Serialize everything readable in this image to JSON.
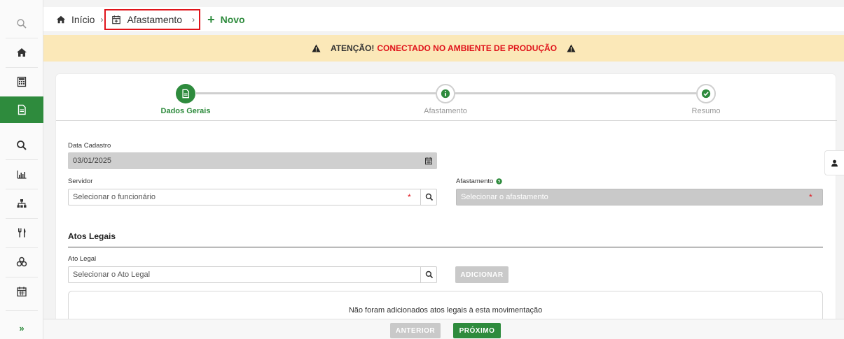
{
  "breadcrumb": {
    "home": "Início",
    "section": "Afastamento",
    "action": "Novo"
  },
  "warning": {
    "prefix": "ATENÇÃO!",
    "message": "CONECTADO NO AMBIENTE DE PRODUÇÃO"
  },
  "steps": [
    {
      "label": "Dados Gerais",
      "state": "active"
    },
    {
      "label": "Afastamento",
      "state": "pending"
    },
    {
      "label": "Resumo",
      "state": "pending"
    }
  ],
  "form": {
    "data_cadastro_label": "Data Cadastro",
    "data_cadastro_value": "03/01/2025",
    "servidor_label": "Servidor",
    "servidor_placeholder": "Selecionar o funcionário",
    "afastamento_label": "Afastamento",
    "afastamento_placeholder": "Selecionar o afastamento"
  },
  "atos": {
    "title": "Atos Legais",
    "field_label": "Ato Legal",
    "placeholder": "Selecionar o Ato Legal",
    "add_button": "ADICIONAR",
    "empty_message": "Não foram adicionados atos legais à esta movimentação"
  },
  "footer": {
    "prev": "ANTERIOR",
    "next": "PRÓXIMO"
  },
  "colors": {
    "primary": "#2e8b3d",
    "warning_bg": "#fbe8b8",
    "danger": "#e0141b"
  },
  "sidebar_icons": [
    "search-icon",
    "home-icon",
    "calculator-icon",
    "document-icon",
    "magnifier-icon",
    "bar-chart-icon",
    "sitemap-icon",
    "utensils-icon",
    "cubes-icon",
    "calendar-icon",
    "expand-icon"
  ]
}
